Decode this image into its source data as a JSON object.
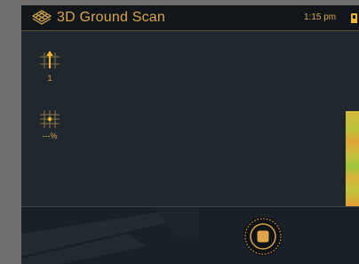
{
  "header": {
    "title": "3D Ground Scan",
    "time": "1:15 pm",
    "logo_icon": "layers-logo-icon",
    "battery_icon": "battery-icon"
  },
  "sidebar": {
    "items": [
      {
        "icon": "grid-arrow-up-icon",
        "label": "1"
      },
      {
        "icon": "grid-crosshair-icon",
        "label": "---%"
      }
    ]
  },
  "controls": {
    "record_icon": "stop-icon"
  },
  "colors": {
    "accent": "#d8a548",
    "background": "#20272d",
    "header": "#11161b",
    "scan_highlight": "#e39d36"
  }
}
